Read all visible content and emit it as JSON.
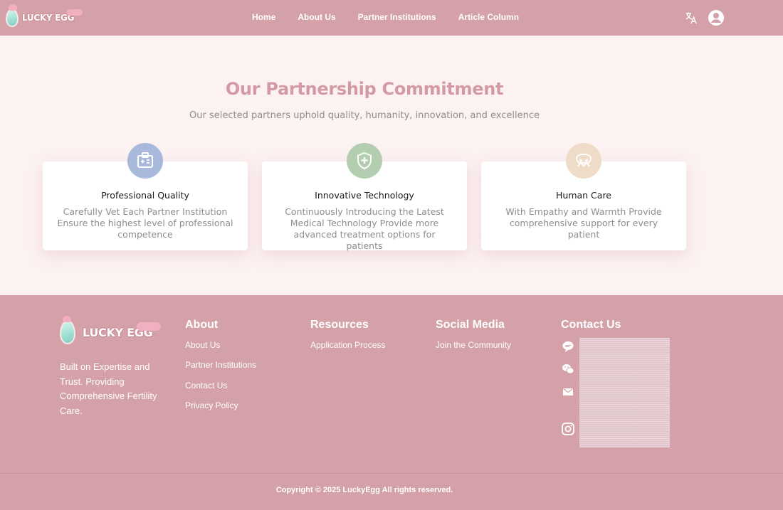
{
  "nav": {
    "logo_text": "LUCKY EGG",
    "links": [
      "Home",
      "About Us",
      "Partner Institutions",
      "Article Column"
    ]
  },
  "hero": {
    "title": "Our Partnership Commitment",
    "subtitle": "Our selected partners uphold quality, humanity, innovation, and excellence"
  },
  "cards": [
    {
      "title": "Professional Quality",
      "desc": "Carefully Vet Each Partner Institution Ensure the highest level of professional competence",
      "icon": "id-card-icon",
      "color": "#a9b9dc"
    },
    {
      "title": "Innovative Technology",
      "desc": "Continuously Introducing the Latest Medical Technology Provide more advanced treatment options for patients",
      "icon": "shield-plus-icon",
      "color": "#b3cdb0"
    },
    {
      "title": "Human Care",
      "desc": "With Empathy and Warmth Provide comprehensive support for every patient",
      "icon": "people-icon",
      "color": "#efdcc8"
    }
  ],
  "footer": {
    "logo_text": "LUCKY EGG",
    "tagline": "Built on Expertise and Trust. Providing Comprehensive Fertility Care.",
    "about": {
      "heading": "About",
      "links": [
        "About Us",
        "Partner Institutions",
        "Contact Us",
        "Privacy Policy"
      ]
    },
    "resources": {
      "heading": "Resources",
      "links": [
        "Application Process"
      ]
    },
    "social": {
      "heading": "Social Media",
      "links": [
        "Join the Community"
      ]
    },
    "contact": {
      "heading": "Contact Us"
    },
    "copyright": "Copyright © 2025 LuckyEgg All rights reserved."
  },
  "colors": {
    "brand": "#d4a1a8",
    "background": "#fcf2f1",
    "title": "#d39aa5"
  }
}
